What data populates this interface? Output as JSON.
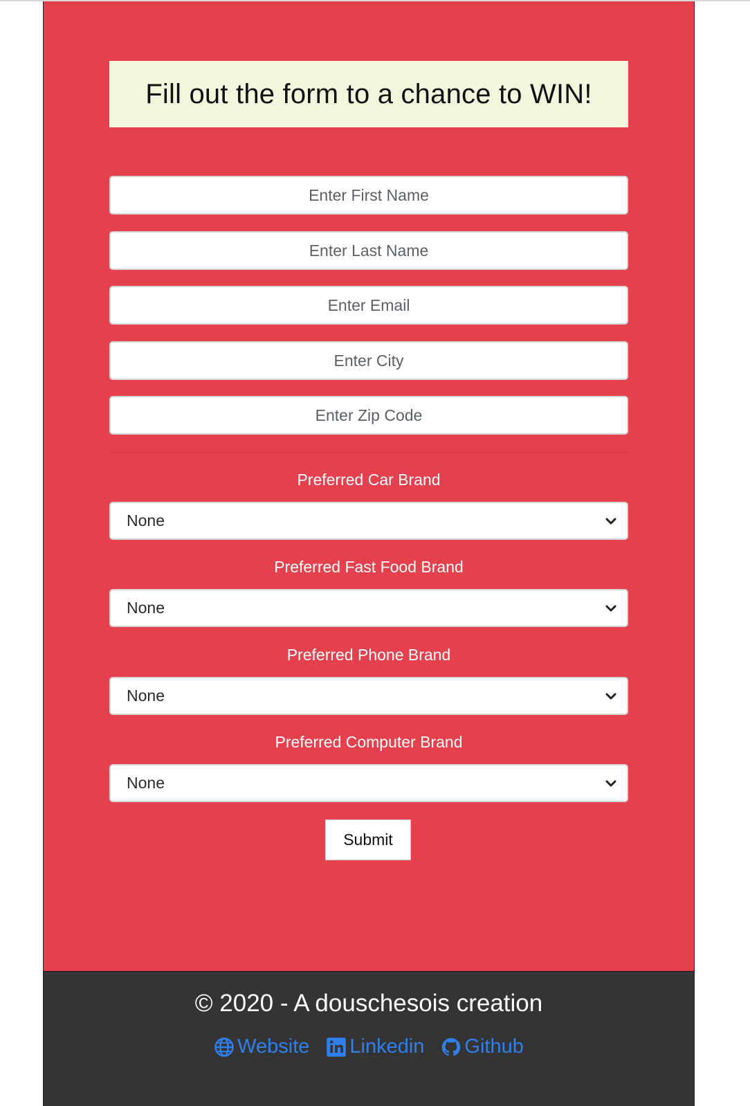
{
  "banner": {
    "title": "Fill out the form to a chance to WIN!"
  },
  "form": {
    "first_name_placeholder": "Enter First Name",
    "last_name_placeholder": "Enter Last Name",
    "email_placeholder": "Enter Email",
    "city_placeholder": "Enter City",
    "zip_placeholder": "Enter Zip Code",
    "selects": [
      {
        "label": "Preferred Car Brand",
        "value": "None"
      },
      {
        "label": "Preferred Fast Food Brand",
        "value": "None"
      },
      {
        "label": "Preferred Phone Brand",
        "value": "None"
      },
      {
        "label": "Preferred Computer Brand",
        "value": "None"
      }
    ],
    "submit_label": "Submit"
  },
  "footer": {
    "credit": "© 2020 - A douschesois creation",
    "links": [
      {
        "label": "Website",
        "icon": "globe-icon"
      },
      {
        "label": "Linkedin",
        "icon": "linkedin-icon"
      },
      {
        "label": "Github",
        "icon": "github-icon"
      }
    ]
  },
  "colors": {
    "form_background": "#e5404d",
    "banner_background": "#f3f5dc",
    "footer_background": "#343434",
    "link_color": "#2f80ed"
  }
}
